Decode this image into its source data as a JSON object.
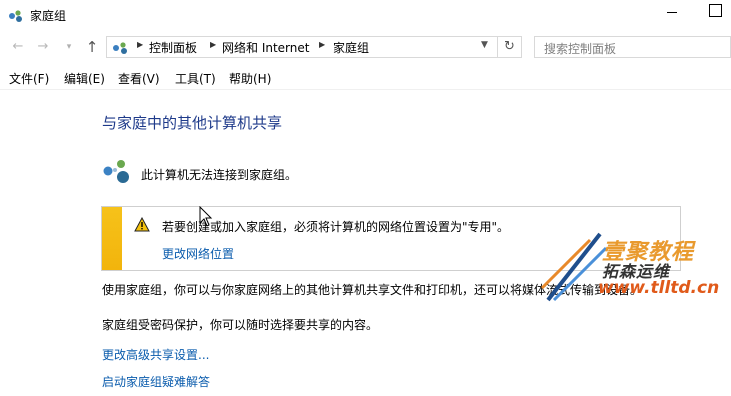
{
  "window": {
    "title": "家庭组"
  },
  "address_bar": {
    "crumbs": [
      "控制面板",
      "网络和 Internet",
      "家庭组"
    ]
  },
  "search": {
    "placeholder": "搜索控制面板"
  },
  "menu": [
    "文件(F)",
    "编辑(E)",
    "查看(V)",
    "工具(T)",
    "帮助(H)"
  ],
  "main": {
    "heading": "与家庭中的其他计算机共享",
    "status": "此计算机无法连接到家庭组。",
    "warning": {
      "text": "若要创建或加入家庭组，必须将计算机的网络位置设置为\"专用\"。",
      "link": "更改网络位置"
    },
    "description": "使用家庭组，你可以与你家庭网络上的其他计算机共享文件和打印机，还可以将媒体流式传输到设备。",
    "password_note": "家庭组受密码保护，你可以随时选择要共享的内容。",
    "links": [
      "更改高级共享设置...",
      "启动家庭组疑难解答"
    ]
  },
  "watermark": {
    "line1": "壹聚教程",
    "line2": "拓森运维",
    "url": "www.tlltd.cn"
  },
  "colors": {
    "heading": "#1e3a8a",
    "link": "#0b5cad",
    "warning_bar": "#f6c21a"
  },
  "icons": [
    "homegroup-icon",
    "back-arrow-icon",
    "forward-arrow-icon",
    "up-arrow-icon",
    "refresh-icon",
    "warning-icon",
    "chevron-down-icon"
  ]
}
